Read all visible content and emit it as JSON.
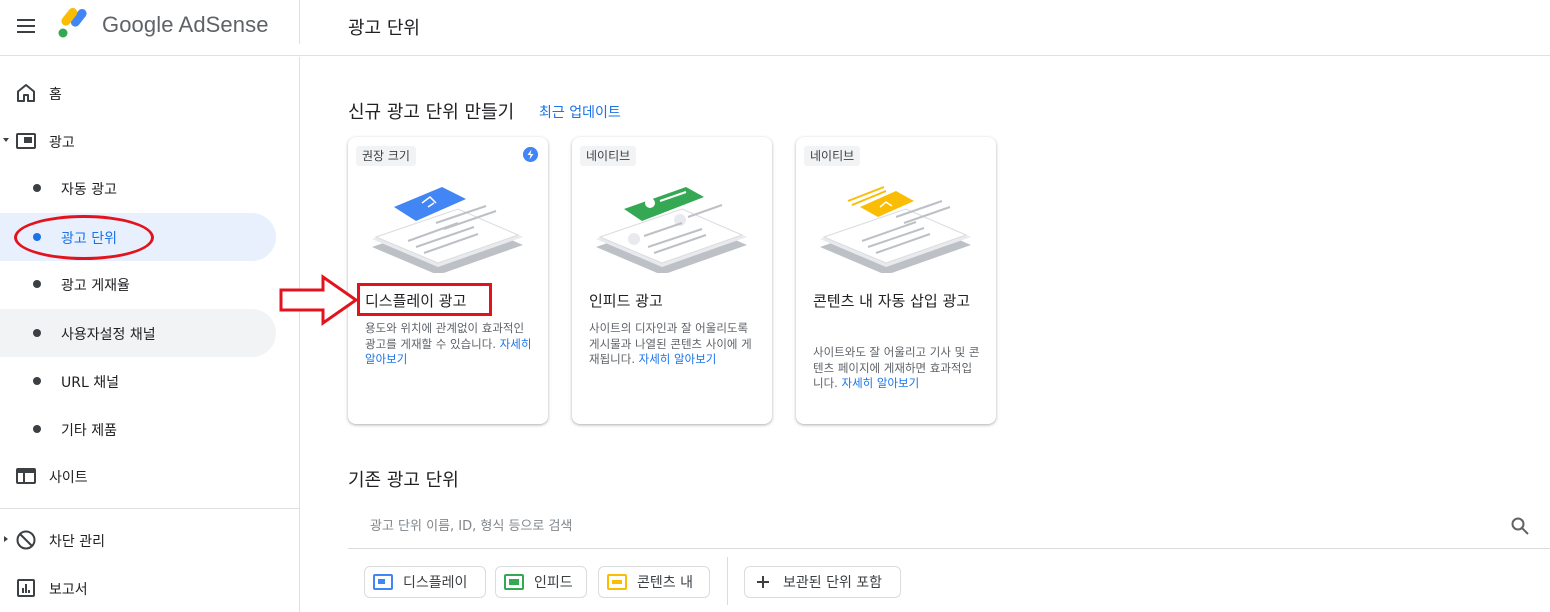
{
  "app": {
    "brand": "Google AdSense",
    "page_title": "광고 단위"
  },
  "sidebar": {
    "items": [
      {
        "label": "홈",
        "icon": "home-icon"
      },
      {
        "label": "광고",
        "icon": "ad-icon"
      },
      {
        "label": "자동 광고"
      },
      {
        "label": "광고 단위",
        "active": true
      },
      {
        "label": "광고 게재율"
      },
      {
        "label": "사용자설정 채널"
      },
      {
        "label": "URL 채널"
      },
      {
        "label": "기타 제품"
      },
      {
        "label": "사이트",
        "icon": "site-icon"
      },
      {
        "label": "차단 관리",
        "icon": "block-icon"
      },
      {
        "label": "보고서",
        "icon": "report-icon"
      }
    ]
  },
  "main": {
    "new_section_title": "신규 광고 단위 만들기",
    "recent_updates_link": "최근 업데이트",
    "cards": [
      {
        "chip": "권장 크기",
        "title": "디스플레이 광고",
        "desc": "용도와 위치에 관계없이 효과적인 광고를 게재할 수 있습니다.",
        "learn_more": "자세히 알아보기",
        "accent": "#4285f4"
      },
      {
        "chip": "네이티브",
        "title": "인피드 광고",
        "desc": "사이트의 디자인과 잘 어울리도록 게시물과 나열된 콘텐츠 사이에 게재됩니다.",
        "learn_more": "자세히 알아보기",
        "accent": "#34a853"
      },
      {
        "chip": "네이티브",
        "title": "콘텐츠 내 자동 삽입 광고",
        "desc": "사이트와도 잘 어울리고 기사 및 콘텐츠 페이지에 게재하면 효과적입니다.",
        "learn_more": "자세히 알아보기",
        "accent": "#fbbc04"
      }
    ],
    "existing_section_title": "기존 광고 단위",
    "search": {
      "placeholder": "광고 단위 이름, ID, 형식 등으로 검색"
    },
    "filters": [
      {
        "label": "디스플레이",
        "color": "#4285f4"
      },
      {
        "label": "인피드",
        "color": "#34a853"
      },
      {
        "label": "콘텐츠 내",
        "color": "#fbbc04"
      }
    ],
    "archived_filter": "보관된 단위 포함"
  }
}
